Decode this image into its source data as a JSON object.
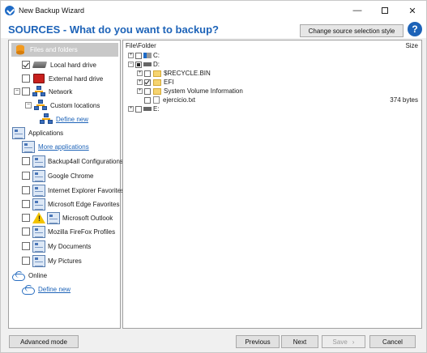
{
  "window": {
    "title": "New Backup Wizard",
    "minimize": "—",
    "close": "✕"
  },
  "header": {
    "title": "SOURCES - What do you want to backup?",
    "change_source_label": "Change source selection style",
    "help": "?"
  },
  "left_panel": {
    "files_header": "Files and folders",
    "local_hard_drive": "Local hard drive",
    "external_hard_drive": "External hard drive",
    "network": "Network",
    "custom_locations": "Custom locations",
    "define_new_network": "Define new",
    "applications": "Applications",
    "more_applications": "More applications",
    "apps": [
      "Backup4all Configurations",
      "Google Chrome",
      "Internet Explorer Favorites",
      "Microsoft Edge Favorites",
      "Microsoft Outlook",
      "Mozilla FireFox Profiles",
      "My Documents",
      "My Pictures"
    ],
    "online": "Online",
    "define_new_online": "Define new"
  },
  "right_panel": {
    "col_folder": "File\\Folder",
    "col_size": "Size",
    "drive_c": "C:",
    "drive_d": "D:",
    "recycle_bin": "$RECYCLE.BIN",
    "efi": "EFI",
    "system_volume": "System Volume Information",
    "ejercicio": "ejercicio.txt",
    "ejercicio_size": "374 bytes",
    "drive_e": "E:"
  },
  "buttons": {
    "advanced": "Advanced mode",
    "previous": "Previous",
    "next": "Next",
    "save": "Save",
    "cancel": "Cancel"
  },
  "icons": [
    "app-icon",
    "database-icon",
    "hard-drive-icon",
    "external-drive-icon",
    "network-icon",
    "application-icon",
    "warning-icon",
    "cloud-icon",
    "folder-icon",
    "file-icon",
    "help-icon"
  ]
}
